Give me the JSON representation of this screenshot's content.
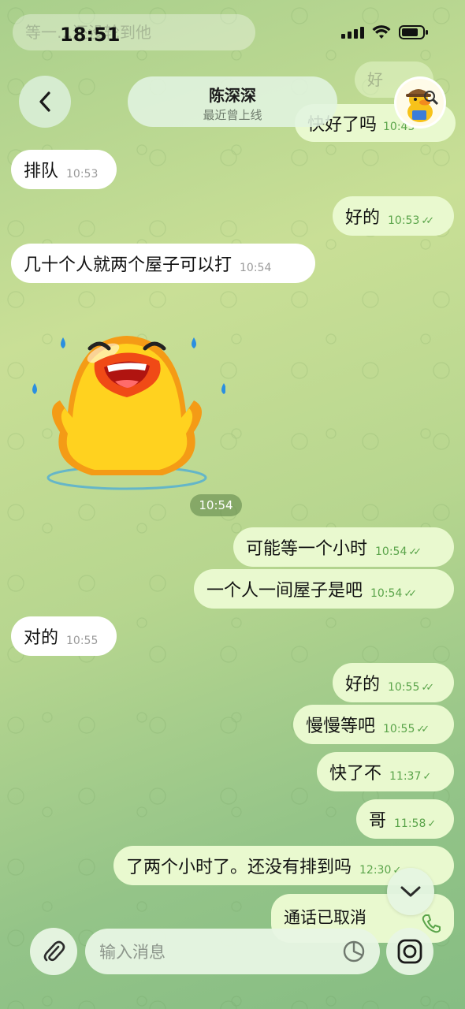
{
  "status_bar": {
    "time": "18:51"
  },
  "header": {
    "contact_name": "陈深深",
    "contact_status": "最近曾上线"
  },
  "background_peek": {
    "top_left_bubble": "等一…还没轮到他",
    "top_right_1": "好",
    "top_right_2": "快好了吗",
    "top_right_2_time": "10:45"
  },
  "messages": [
    {
      "dir": "in",
      "text": "排队",
      "time": "10:53"
    },
    {
      "dir": "out",
      "text": "好的",
      "time": "10:53",
      "read": true
    },
    {
      "dir": "in",
      "text": "几十个人就两个屋子可以打",
      "time": "10:54"
    },
    {
      "dir": "out",
      "text": "可能等一个小时",
      "time": "10:54",
      "read": true
    },
    {
      "dir": "out",
      "text": "一个人一间屋子是吧",
      "time": "10:54",
      "read": true
    },
    {
      "dir": "in",
      "text": "对的",
      "time": "10:55"
    },
    {
      "dir": "out",
      "text": "好的",
      "time": "10:55",
      "read": true
    },
    {
      "dir": "out",
      "text": "慢慢等吧",
      "time": "10:55",
      "read": true
    },
    {
      "dir": "out",
      "text": "快了不",
      "time": "11:37",
      "read": false
    },
    {
      "dir": "out",
      "text": "哥",
      "time": "11:58",
      "read": false
    },
    {
      "dir": "out",
      "text": "了两个小时了。还没有排到吗",
      "time": "12:30",
      "read": false
    }
  ],
  "sticker": {
    "time": "10:54",
    "icon": "laughing-duck-sticker"
  },
  "call": {
    "text": "通话已取消",
    "icon": "phone-icon"
  },
  "input": {
    "placeholder": "输入消息"
  },
  "colors": {
    "incoming_bubble": "#ffffff",
    "outgoing_bubble": "#e9f9cf",
    "check_green": "#5aa44a"
  }
}
